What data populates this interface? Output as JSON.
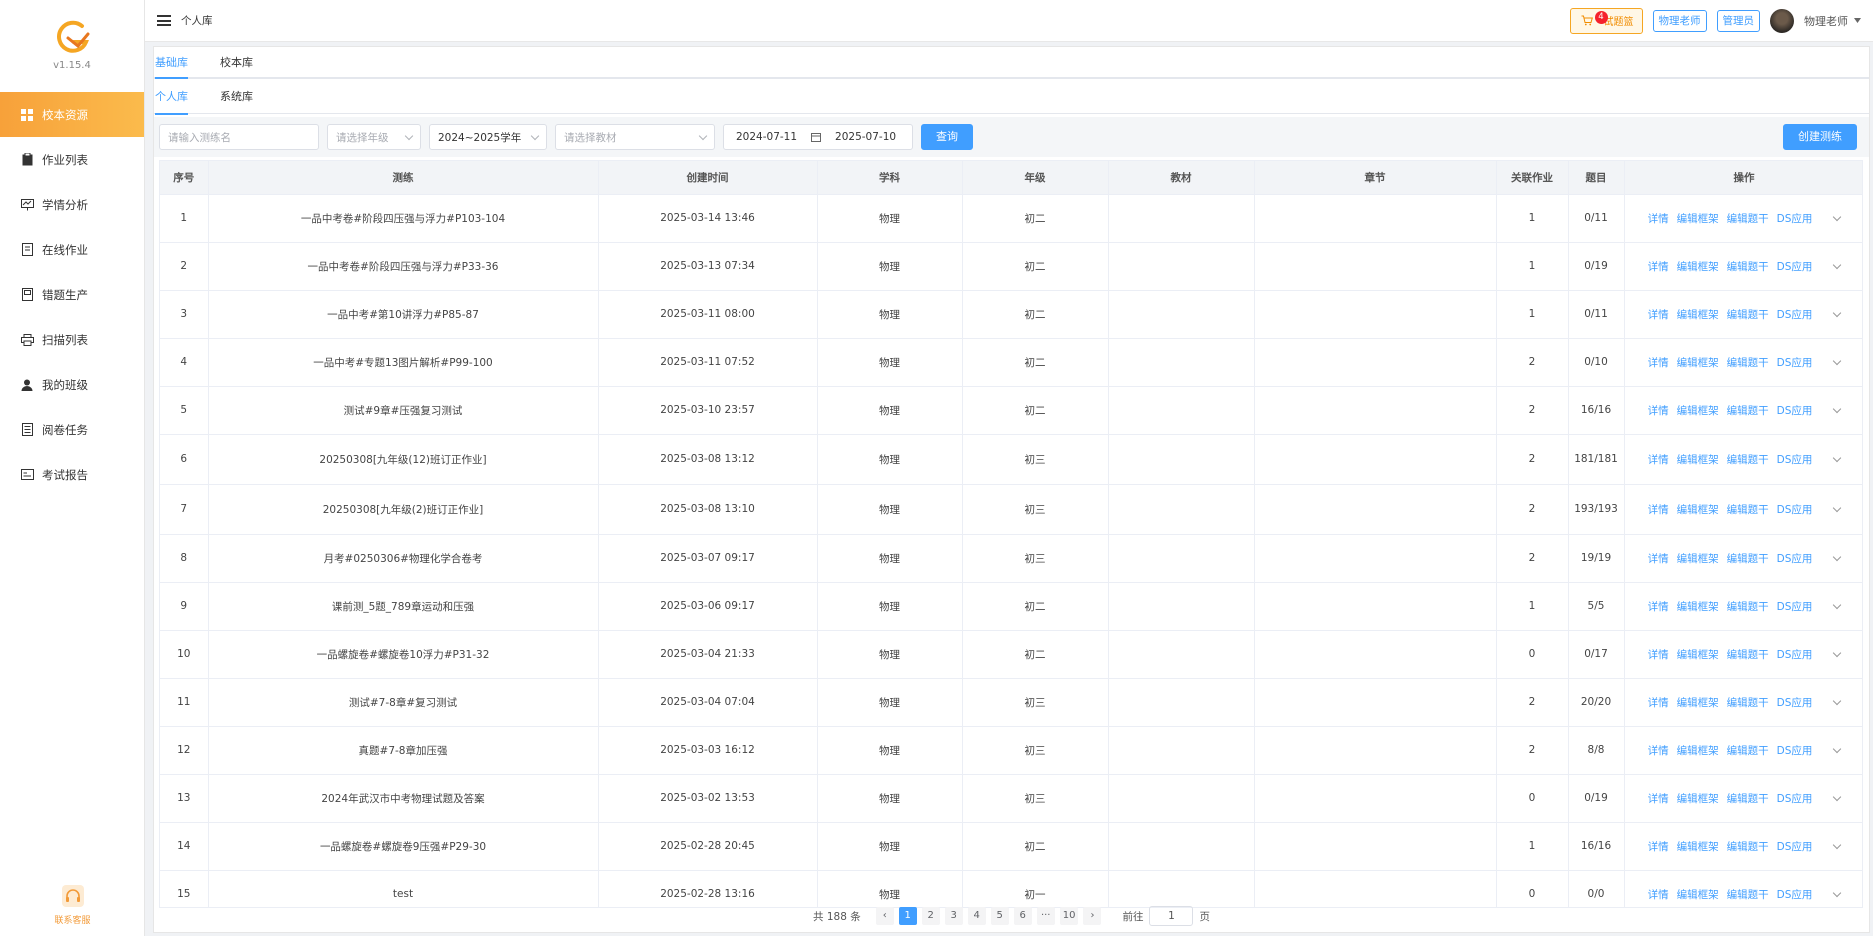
{
  "app": {
    "version": "v1.15.4",
    "support_label": "联系客服"
  },
  "sidebar": {
    "items": [
      {
        "label": "校本资源",
        "icon": "grid-icon",
        "active": true
      },
      {
        "label": "作业列表",
        "icon": "clipboard-icon"
      },
      {
        "label": "学情分析",
        "icon": "chart-monitor-icon"
      },
      {
        "label": "在线作业",
        "icon": "document-icon"
      },
      {
        "label": "错题生产",
        "icon": "book-icon"
      },
      {
        "label": "扫描列表",
        "icon": "printer-icon"
      },
      {
        "label": "我的班级",
        "icon": "user-icon"
      },
      {
        "label": "阅卷任务",
        "icon": "list-icon"
      },
      {
        "label": "考试报告",
        "icon": "report-icon"
      }
    ]
  },
  "header": {
    "breadcrumb": "个人库",
    "basket_label": "试题篮",
    "basket_count": "4",
    "role1": "物理老师",
    "role2": "管理员",
    "username": "物理老师"
  },
  "tabs": {
    "level1": [
      "基础库",
      "校本库"
    ],
    "level2": [
      "个人库",
      "系统库"
    ]
  },
  "filters": {
    "name_placeholder": "请输入测练名",
    "grade_placeholder": "请选择年级",
    "year_value": "2024~2025学年",
    "textbook_placeholder": "请选择教材",
    "date_start": "2024-07-11",
    "date_end": "2025-07-10",
    "query_label": "查询",
    "create_label": "创建测练"
  },
  "table": {
    "columns": [
      "序号",
      "测练",
      "创建时间",
      "学科",
      "年级",
      "教材",
      "章节",
      "关联作业",
      "题目",
      "操作"
    ],
    "actions": [
      "详情",
      "编辑框架",
      "编辑题干",
      "DS应用"
    ],
    "rows": [
      {
        "no": "1",
        "name": "一品中考卷#阶段四压强与浮力#P103-104",
        "time": "2025-03-14 13:46",
        "subject": "物理",
        "grade": "初二",
        "textbook": "",
        "chapter": "",
        "linked": "1",
        "questions": "0/11"
      },
      {
        "no": "2",
        "name": "一品中考卷#阶段四压强与浮力#P33-36",
        "time": "2025-03-13 07:34",
        "subject": "物理",
        "grade": "初二",
        "textbook": "",
        "chapter": "",
        "linked": "1",
        "questions": "0/19"
      },
      {
        "no": "3",
        "name": "一品中考#第10讲浮力#P85-87",
        "time": "2025-03-11 08:00",
        "subject": "物理",
        "grade": "初二",
        "textbook": "",
        "chapter": "",
        "linked": "1",
        "questions": "0/11"
      },
      {
        "no": "4",
        "name": "一品中考#专题13图片解析#P99-100",
        "time": "2025-03-11 07:52",
        "subject": "物理",
        "grade": "初二",
        "textbook": "",
        "chapter": "",
        "linked": "2",
        "questions": "0/10"
      },
      {
        "no": "5",
        "name": "测试#9章#压强复习测试",
        "time": "2025-03-10 23:57",
        "subject": "物理",
        "grade": "初二",
        "textbook": "",
        "chapter": "",
        "linked": "2",
        "questions": "16/16"
      },
      {
        "no": "6",
        "name": "20250308[九年级(12)班订正作业]",
        "time": "2025-03-08 13:12",
        "subject": "物理",
        "grade": "初三",
        "textbook": "",
        "chapter": "",
        "linked": "2",
        "questions": "181/181"
      },
      {
        "no": "7",
        "name": "20250308[九年级(2)班订正作业]",
        "time": "2025-03-08 13:10",
        "subject": "物理",
        "grade": "初三",
        "textbook": "",
        "chapter": "",
        "linked": "2",
        "questions": "193/193"
      },
      {
        "no": "8",
        "name": "月考#0250306#物理化学合卷考",
        "time": "2025-03-07 09:17",
        "subject": "物理",
        "grade": "初三",
        "textbook": "",
        "chapter": "",
        "linked": "2",
        "questions": "19/19"
      },
      {
        "no": "9",
        "name": "课前测_5题_789章运动和压强",
        "time": "2025-03-06 09:17",
        "subject": "物理",
        "grade": "初二",
        "textbook": "",
        "chapter": "",
        "linked": "1",
        "questions": "5/5"
      },
      {
        "no": "10",
        "name": "一品螺旋卷#螺旋卷10浮力#P31-32",
        "time": "2025-03-04 21:33",
        "subject": "物理",
        "grade": "初二",
        "textbook": "",
        "chapter": "",
        "linked": "0",
        "questions": "0/17"
      },
      {
        "no": "11",
        "name": "测试#7-8章#复习测试",
        "time": "2025-03-04 07:04",
        "subject": "物理",
        "grade": "初三",
        "textbook": "",
        "chapter": "",
        "linked": "2",
        "questions": "20/20"
      },
      {
        "no": "12",
        "name": "真题#7-8章加压强",
        "time": "2025-03-03 16:12",
        "subject": "物理",
        "grade": "初三",
        "textbook": "",
        "chapter": "",
        "linked": "2",
        "questions": "8/8"
      },
      {
        "no": "13",
        "name": "2024年武汉市中考物理试题及答案",
        "time": "2025-03-02 13:53",
        "subject": "物理",
        "grade": "初三",
        "textbook": "",
        "chapter": "",
        "linked": "0",
        "questions": "0/19"
      },
      {
        "no": "14",
        "name": "一品螺旋卷#螺旋卷9压强#P29-30",
        "time": "2025-02-28 20:45",
        "subject": "物理",
        "grade": "初二",
        "textbook": "",
        "chapter": "",
        "linked": "1",
        "questions": "16/16"
      },
      {
        "no": "15",
        "name": "test",
        "time": "2025-02-28 13:16",
        "subject": "物理",
        "grade": "初一",
        "textbook": "",
        "chapter": "",
        "linked": "0",
        "questions": "0/0"
      }
    ]
  },
  "pagination": {
    "total_label": "共 188 条",
    "pages": [
      "1",
      "2",
      "3",
      "4",
      "5",
      "6",
      "···",
      "10"
    ],
    "current": "1",
    "goto_prefix": "前往",
    "goto_value": "1",
    "goto_suffix": "页"
  },
  "colors": {
    "accent": "#409eff",
    "sidebar_active": "#f7a13a",
    "basket": "#f08c00"
  }
}
